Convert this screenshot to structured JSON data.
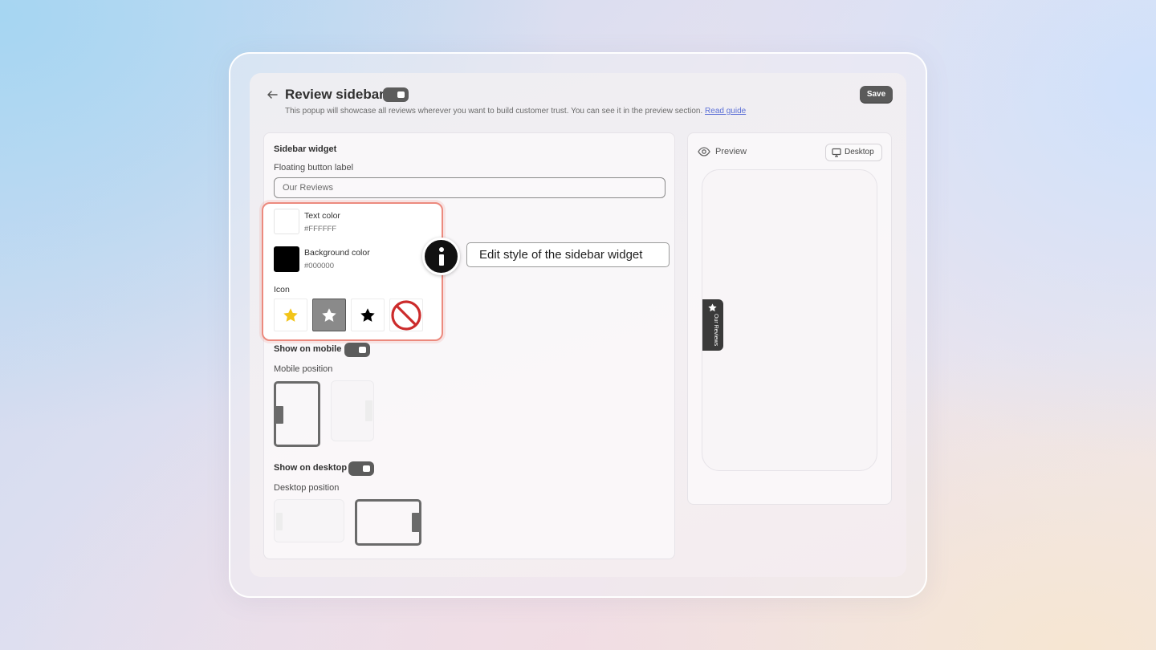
{
  "header": {
    "title": "Review sidebar",
    "subtitle": "This popup will showcase all reviews wherever you want to build customer trust. You can see it in the preview section.",
    "guide_link": "Read guide",
    "save_label": "Save"
  },
  "widget": {
    "section_title": "Sidebar widget",
    "floating_label_title": "Floating button label",
    "floating_label_value": "Our Reviews",
    "text_color_label": "Text color",
    "text_color_value": "#FFFFFF",
    "bg_color_label": "Background color",
    "bg_color_value": "#000000",
    "icon_label": "Icon",
    "icons": [
      "star-gold-icon",
      "star-white-icon",
      "star-black-icon",
      "no-icon"
    ],
    "selected_icon_index": 1
  },
  "tooltip": {
    "text": "Edit style of the sidebar widget"
  },
  "mobile": {
    "toggle_label": "Show on mobile",
    "toggle_on": true,
    "position_label": "Mobile position",
    "selected_position": "left"
  },
  "desktop": {
    "toggle_label": "Show on desktop",
    "toggle_on": true,
    "position_label": "Desktop position",
    "selected_position": "right"
  },
  "preview": {
    "label": "Preview",
    "device_label": "Desktop",
    "tab_text": "Our Reviews"
  },
  "colors": {
    "accent_outline": "#ec8a7e",
    "toggle_on": "#5c5c5c",
    "link": "#5b6fd6"
  }
}
